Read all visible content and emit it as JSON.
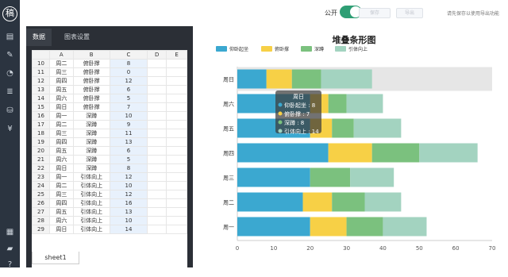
{
  "app": {
    "logo_char": "稿"
  },
  "sidebar": {
    "icons": [
      "file-icon",
      "edit-icon",
      "pie-icon",
      "layers-icon",
      "database-icon",
      "yen-icon",
      "grid-icon",
      "chat-icon",
      "help-icon"
    ]
  },
  "topbar": {
    "toggle_label": "公开",
    "btn1": "保存",
    "btn2": "导出",
    "hint": "请先保存以使用导出功能"
  },
  "panel": {
    "tabs": [
      {
        "label": "数据"
      },
      {
        "label": "图表设置"
      }
    ],
    "columns": [
      "A",
      "B",
      "C",
      "D",
      "E"
    ],
    "rows": [
      {
        "n": "10",
        "a": "周二",
        "b": "俯卧撑",
        "c": "8"
      },
      {
        "n": "11",
        "a": "周三",
        "b": "俯卧撑",
        "c": "0"
      },
      {
        "n": "12",
        "a": "周四",
        "b": "俯卧撑",
        "c": "12"
      },
      {
        "n": "13",
        "a": "周五",
        "b": "俯卧撑",
        "c": "6"
      },
      {
        "n": "14",
        "a": "周六",
        "b": "俯卧撑",
        "c": "5"
      },
      {
        "n": "15",
        "a": "周日",
        "b": "俯卧撑",
        "c": "7"
      },
      {
        "n": "16",
        "a": "周一",
        "b": "深蹲",
        "c": "10"
      },
      {
        "n": "17",
        "a": "周二",
        "b": "深蹲",
        "c": "9"
      },
      {
        "n": "18",
        "a": "周三",
        "b": "深蹲",
        "c": "11"
      },
      {
        "n": "19",
        "a": "周四",
        "b": "深蹲",
        "c": "13"
      },
      {
        "n": "20",
        "a": "周五",
        "b": "深蹲",
        "c": "6"
      },
      {
        "n": "21",
        "a": "周六",
        "b": "深蹲",
        "c": "5"
      },
      {
        "n": "22",
        "a": "周日",
        "b": "深蹲",
        "c": "8"
      },
      {
        "n": "23",
        "a": "周一",
        "b": "引体向上",
        "c": "12"
      },
      {
        "n": "24",
        "a": "周二",
        "b": "引体向上",
        "c": "10"
      },
      {
        "n": "25",
        "a": "周三",
        "b": "引体向上",
        "c": "12"
      },
      {
        "n": "26",
        "a": "周四",
        "b": "引体向上",
        "c": "16"
      },
      {
        "n": "27",
        "a": "周五",
        "b": "引体向上",
        "c": "13"
      },
      {
        "n": "28",
        "a": "周六",
        "b": "引体向上",
        "c": "10"
      },
      {
        "n": "29",
        "a": "周日",
        "b": "引体向上",
        "c": "14"
      }
    ],
    "sheet_tab": "sheet1"
  },
  "chart_data": {
    "type": "bar",
    "orientation": "horizontal",
    "stacked": true,
    "title": "堆叠条形图",
    "categories": [
      "周一",
      "周二",
      "周三",
      "周四",
      "周五",
      "周六",
      "周日"
    ],
    "series": [
      {
        "name": "仰卧起坐",
        "color": "#3ba8d0",
        "values": [
          20,
          18,
          20,
          25,
          20,
          20,
          8
        ]
      },
      {
        "name": "俯卧撑",
        "color": "#f7d046",
        "values": [
          10,
          8,
          0,
          12,
          6,
          5,
          7
        ]
      },
      {
        "name": "深蹲",
        "color": "#7bc17e",
        "values": [
          10,
          9,
          11,
          13,
          6,
          5,
          8
        ]
      },
      {
        "name": "引体向上",
        "color": "#a3d3c0",
        "values": [
          12,
          10,
          12,
          16,
          13,
          10,
          14
        ]
      }
    ],
    "xlim": [
      0,
      70
    ],
    "xticks": [
      "0",
      "10",
      "20",
      "30",
      "40",
      "50",
      "60",
      "70"
    ],
    "legend_position": "top-left",
    "highlighted_category": "周日",
    "tooltip": {
      "title": "周日",
      "lines": [
        "仰卧起坐 : 8",
        "俯卧撑 : 7",
        "深蹲 : 8",
        "引体向上 : 14"
      ]
    }
  }
}
